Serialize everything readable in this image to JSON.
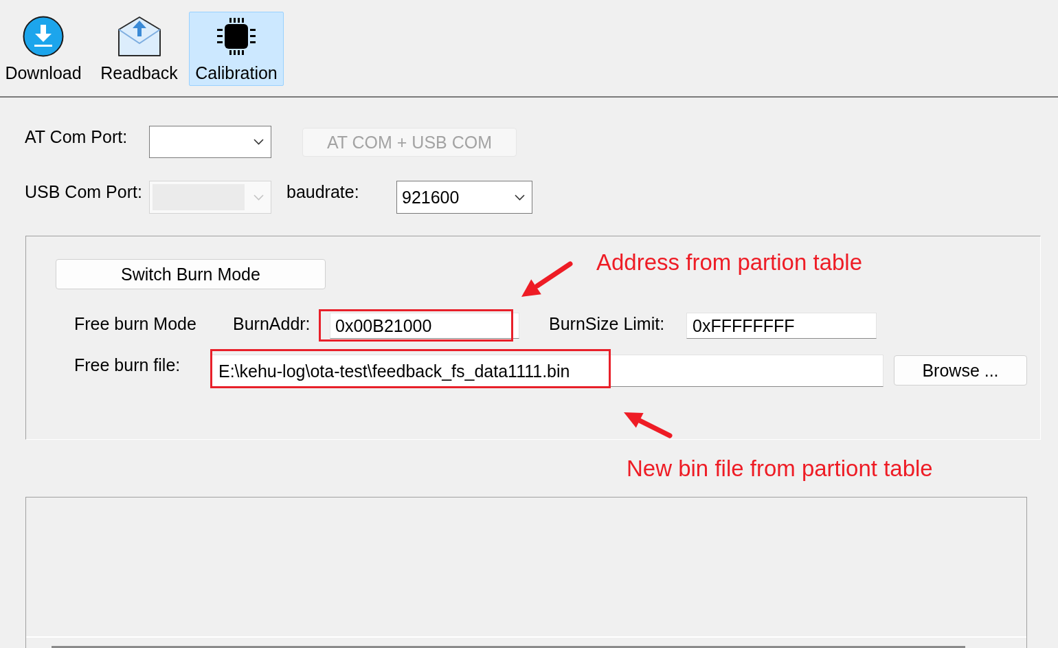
{
  "toolbar": {
    "buttons": [
      {
        "label": "Download",
        "selected": false
      },
      {
        "label": "Readback",
        "selected": false
      },
      {
        "label": "Calibration",
        "selected": true
      }
    ]
  },
  "ports": {
    "at_com_port": {
      "label": "AT Com Port:"
    },
    "combo_button": {
      "label": "AT COM + USB COM",
      "disabled": true
    },
    "usb_com_port": {
      "label": "USB Com Port:",
      "disabled": true
    },
    "baudrate": {
      "label": "baudrate:",
      "value": "921600"
    }
  },
  "burn_group": {
    "switch_button": {
      "label": "Switch Burn Mode"
    },
    "mode_label": "Free burn Mode",
    "burn_addr": {
      "label": "BurnAddr:",
      "value": "0x00B21000",
      "highlighted": true
    },
    "burn_size_limit": {
      "label": "BurnSize Limit:",
      "value": "0xFFFFFFFF"
    },
    "burn_file": {
      "label": "Free burn file:",
      "value": "E:\\kehu-log\\ota-test\\feedback_fs_data1111.bin",
      "highlighted": true
    },
    "browse_button": {
      "label": "Browse ..."
    }
  },
  "annotations": [
    {
      "text": "Address from partion table"
    },
    {
      "text": "New bin file from partiont table"
    }
  ]
}
